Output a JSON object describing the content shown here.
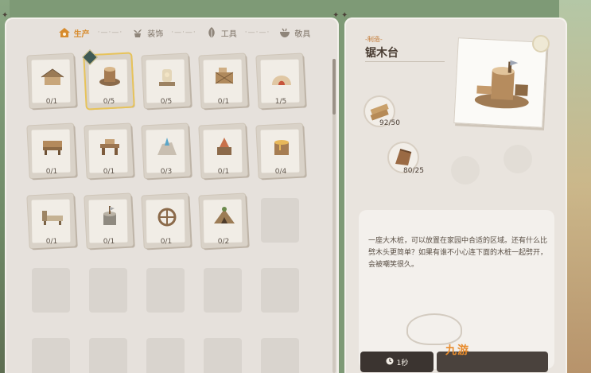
{
  "tabs": [
    {
      "label": "生产",
      "icon": "home-icon",
      "active": true
    },
    {
      "label": "装饰",
      "icon": "plant-icon",
      "active": false
    },
    {
      "label": "工具",
      "icon": "leaf-icon",
      "active": false
    },
    {
      "label": "敬具",
      "icon": "bowl-icon",
      "active": false
    }
  ],
  "tab_separator": "·—·—·",
  "recipes": [
    {
      "name": "thatched-shelter",
      "count": "0/1"
    },
    {
      "name": "stump-table",
      "count": "0/5",
      "selected": true
    },
    {
      "name": "stone-lantern",
      "count": "0/5"
    },
    {
      "name": "wooden-crate",
      "count": "0/1"
    },
    {
      "name": "clay-oven",
      "count": "1/5"
    },
    {
      "name": "wooden-bench",
      "count": "0/1"
    },
    {
      "name": "wood-workbench",
      "count": "0/1"
    },
    {
      "name": "crystal-rock",
      "count": "0/3"
    },
    {
      "name": "anvil-stump",
      "count": "0/1"
    },
    {
      "name": "honey-stump",
      "count": "0/4"
    },
    {
      "name": "stone-bed",
      "count": "0/1"
    },
    {
      "name": "axe-stump",
      "count": "0/1"
    },
    {
      "name": "cart-wheel",
      "count": "0/1"
    },
    {
      "name": "tent-hut",
      "count": "0/2"
    }
  ],
  "empty_slots": 11,
  "detail": {
    "category": "-制造-",
    "title": "锯木台",
    "materials": [
      {
        "icon": "wood-plank-icon",
        "amount": "92/50"
      },
      {
        "icon": "wood-log-icon",
        "amount": "80/25"
      }
    ],
    "description": "一座大木桩，可以放置在家园中合适的区域。还有什么比劈木头更简单？如果有谁不小心连下面的木桩一起劈开，会被嘲笑很久。",
    "time": "1秒"
  },
  "watermark": "九游"
}
